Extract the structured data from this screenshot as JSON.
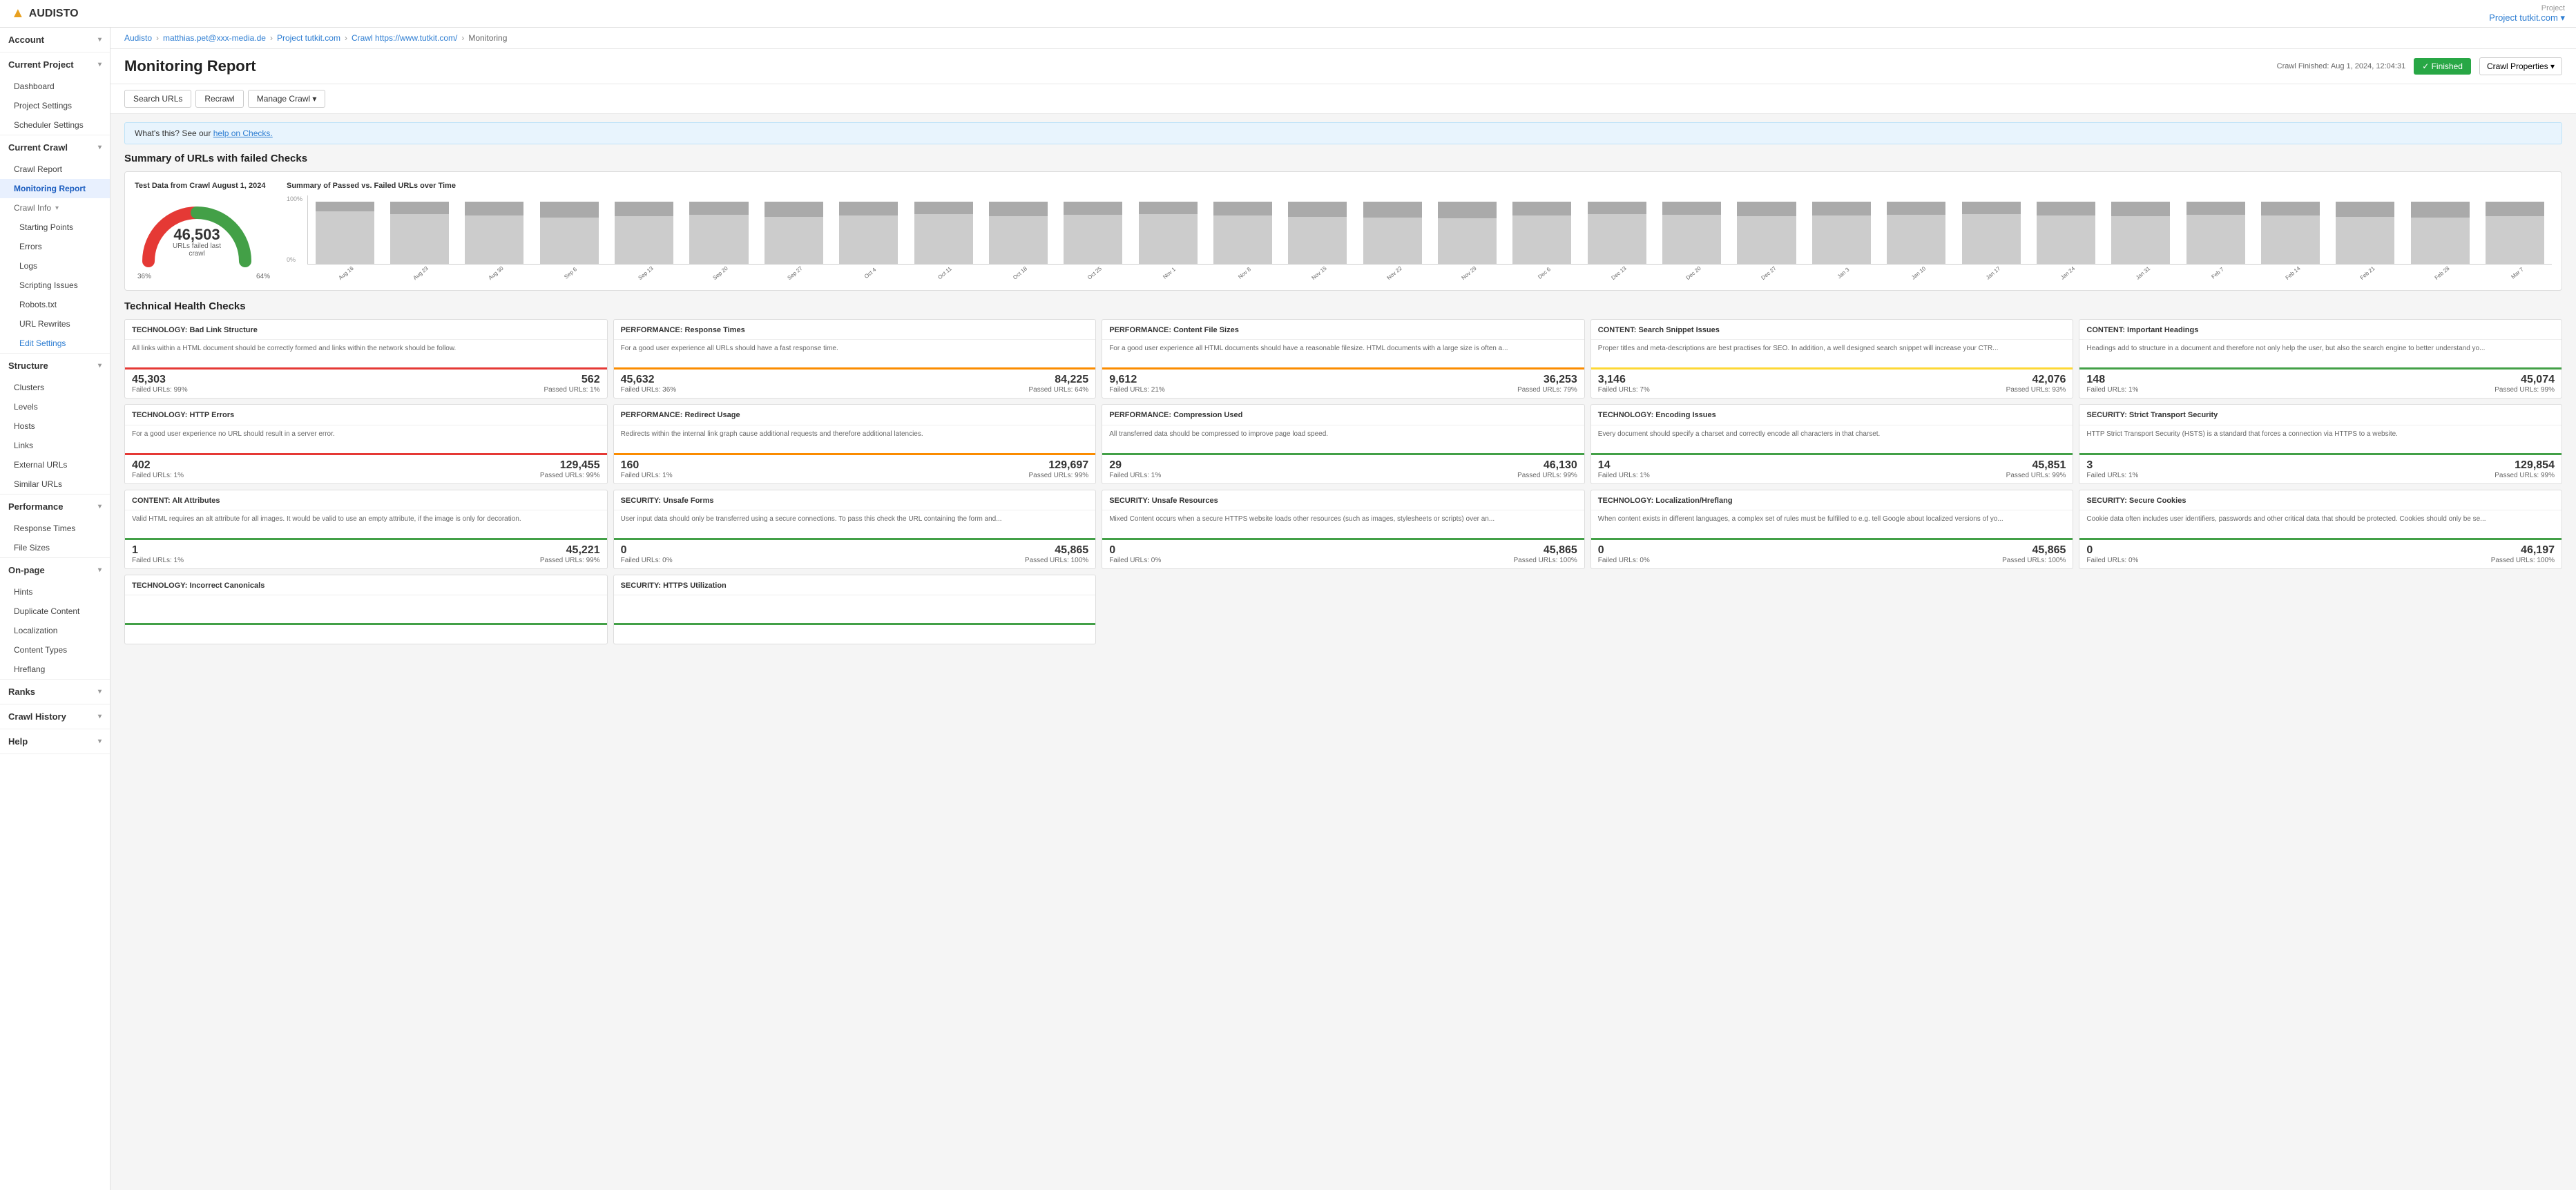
{
  "topbar": {
    "logo_text": "AUDISTO",
    "project_label": "Project",
    "project_name": "Project tutkit.com"
  },
  "breadcrumb": {
    "items": [
      "Audisto",
      "matthias.pet@xxx-media.de",
      "Project tutkit.com",
      "Crawl https://www.tutkit.com/",
      "Monitoring"
    ]
  },
  "page": {
    "title": "Monitoring Report",
    "crawl_finished": "Crawl Finished: Aug 1, 2024, 12:04:31",
    "finished_label": "✓ Finished",
    "crawl_props_label": "Crawl Properties"
  },
  "toolbar": {
    "search_urls": "Search URLs",
    "recrawl": "Recrawl",
    "manage_crawl": "Manage Crawl"
  },
  "info_bar": {
    "text": "What's this? See our ",
    "link_text": "help on Checks.",
    "link_href": "#"
  },
  "summary": {
    "title": "Summary of URLs with failed Checks",
    "gauge": {
      "title": "Test Data from Crawl August 1, 2024",
      "number": "46,503",
      "label": "URLs failed last crawl",
      "pct_left": "36%",
      "pct_right": "64%"
    },
    "chart": {
      "title": "Summary of Passed vs. Failed URLs over Time",
      "y_labels": [
        "100%",
        "0%"
      ],
      "bars": [
        {
          "label": "Aug 16",
          "passed": 85,
          "failed": 15
        },
        {
          "label": "Aug 23",
          "passed": 80,
          "failed": 20
        },
        {
          "label": "Aug 30",
          "passed": 78,
          "failed": 22
        },
        {
          "label": "Sep 6",
          "passed": 75,
          "failed": 25
        },
        {
          "label": "Sep 13",
          "passed": 77,
          "failed": 23
        },
        {
          "label": "Sep 20",
          "passed": 79,
          "failed": 21
        },
        {
          "label": "Sep 27",
          "passed": 76,
          "failed": 24
        },
        {
          "label": "Oct 4",
          "passed": 78,
          "failed": 22
        },
        {
          "label": "Oct 11",
          "passed": 80,
          "failed": 20
        },
        {
          "label": "Oct 18",
          "passed": 77,
          "failed": 23
        },
        {
          "label": "Oct 25",
          "passed": 79,
          "failed": 21
        },
        {
          "label": "Nov 1",
          "passed": 80,
          "failed": 20
        },
        {
          "label": "Nov 8",
          "passed": 78,
          "failed": 22
        },
        {
          "label": "Nov 15",
          "passed": 76,
          "failed": 24
        },
        {
          "label": "Nov 22",
          "passed": 75,
          "failed": 25
        },
        {
          "label": "Nov 29",
          "passed": 73,
          "failed": 27
        },
        {
          "label": "Dec 6",
          "passed": 78,
          "failed": 22
        },
        {
          "label": "Dec 13",
          "passed": 80,
          "failed": 20
        },
        {
          "label": "Dec 20",
          "passed": 79,
          "failed": 21
        },
        {
          "label": "Dec 27",
          "passed": 77,
          "failed": 23
        },
        {
          "label": "Jan 3",
          "passed": 78,
          "failed": 22
        },
        {
          "label": "Jan 10",
          "passed": 79,
          "failed": 21
        },
        {
          "label": "Jan 17",
          "passed": 80,
          "failed": 20
        },
        {
          "label": "Jan 24",
          "passed": 78,
          "failed": 22
        },
        {
          "label": "Jan 31",
          "passed": 77,
          "failed": 23
        },
        {
          "label": "Feb 7",
          "passed": 79,
          "failed": 21
        },
        {
          "label": "Feb 14",
          "passed": 78,
          "failed": 22
        },
        {
          "label": "Feb 21",
          "passed": 76,
          "failed": 24
        },
        {
          "label": "Feb 28",
          "passed": 75,
          "failed": 25
        },
        {
          "label": "Mar 7",
          "passed": 77,
          "failed": 23
        }
      ]
    }
  },
  "health": {
    "title": "Technical Health Checks",
    "cards_row1": [
      {
        "title": "TECHNOLOGY: Bad Link Structure",
        "desc": "All links within a HTML document should be correctly formed and links within the network should be follow.",
        "num_left": "45,303",
        "label_left": "Failed URLs: 99%",
        "num_right": "562",
        "label_right": "Passed URLs: 1%",
        "color": "red"
      },
      {
        "title": "PERFORMANCE: Response Times",
        "desc": "For a good user experience all URLs should have a fast response time.",
        "num_left": "45,632",
        "label_left": "Failed URLs: 36%",
        "num_right": "84,225",
        "label_right": "Passed URLs: 64%",
        "color": "orange"
      },
      {
        "title": "PERFORMANCE: Content File Sizes",
        "desc": "For a good user experience all HTML documents should have a reasonable filesize. HTML documents with a large size is often a...",
        "num_left": "9,612",
        "label_left": "Failed URLs: 21%",
        "num_right": "36,253",
        "label_right": "Passed URLs: 79%",
        "color": "orange"
      },
      {
        "title": "CONTENT: Search Snippet Issues",
        "desc": "Proper titles and meta-descriptions are best practises for SEO. In addition, a well designed search snippet will increase your CTR...",
        "num_left": "3,146",
        "label_left": "Failed URLs: 7%",
        "num_right": "42,076",
        "label_right": "Passed URLs: 93%",
        "color": "yellow"
      },
      {
        "title": "CONTENT: Important Headings",
        "desc": "Headings add to structure in a document and therefore not only help the user, but also the search engine to better understand yo...",
        "num_left": "148",
        "label_left": "Failed URLs: 1%",
        "num_right": "45,074",
        "label_right": "Passed URLs: 99%",
        "color": "green"
      }
    ],
    "cards_row2": [
      {
        "title": "TECHNOLOGY: HTTP Errors",
        "desc": "For a good user experience no URL should result in a server error.",
        "num_left": "402",
        "label_left": "Failed URLs: 1%",
        "num_right": "129,455",
        "label_right": "Passed URLs: 99%",
        "color": "red"
      },
      {
        "title": "PERFORMANCE: Redirect Usage",
        "desc": "Redirects within the internal link graph cause additional requests and therefore additional latencies.",
        "num_left": "160",
        "label_left": "Failed URLs: 1%",
        "num_right": "129,697",
        "label_right": "Passed URLs: 99%",
        "color": "orange"
      },
      {
        "title": "PERFORMANCE: Compression Used",
        "desc": "All transferred data should be compressed to improve page load speed.",
        "num_left": "29",
        "label_left": "Failed URLs: 1%",
        "num_right": "46,130",
        "label_right": "Passed URLs: 99%",
        "color": "green"
      },
      {
        "title": "TECHNOLOGY: Encoding Issues",
        "desc": "Every document should specify a charset and correctly encode all characters in that charset.",
        "num_left": "14",
        "label_left": "Failed URLs: 1%",
        "num_right": "45,851",
        "label_right": "Passed URLs: 99%",
        "color": "green"
      },
      {
        "title": "SECURITY: Strict Transport Security",
        "desc": "HTTP Strict Transport Security (HSTS) is a standard that forces a connection via HTTPS to a website.",
        "num_left": "3",
        "label_left": "Failed URLs: 1%",
        "num_right": "129,854",
        "label_right": "Passed URLs: 99%",
        "color": "green"
      }
    ],
    "cards_row3": [
      {
        "title": "CONTENT: Alt Attributes",
        "desc": "Valid HTML requires an alt attribute for all images. It would be valid to use an empty attribute, if the image is only for decoration.",
        "num_left": "1",
        "label_left": "Failed URLs: 1%",
        "num_right": "45,221",
        "label_right": "Passed URLs: 99%",
        "color": "green"
      },
      {
        "title": "SECURITY: Unsafe Forms",
        "desc": "User input data should only be transferred using a secure connections. To pass this check the URL containing the form and...",
        "num_left": "0",
        "label_left": "Failed URLs: 0%",
        "num_right": "45,865",
        "label_right": "Passed URLs: 100%",
        "color": "green"
      },
      {
        "title": "SECURITY: Unsafe Resources",
        "desc": "Mixed Content occurs when a secure HTTPS website loads other resources (such as images, stylesheets or scripts) over an...",
        "num_left": "0",
        "label_left": "Failed URLs: 0%",
        "num_right": "45,865",
        "label_right": "Passed URLs: 100%",
        "color": "green"
      },
      {
        "title": "TECHNOLOGY: Localization/Hreflang",
        "desc": "When content exists in different languages, a complex set of rules must be fulfilled to e.g. tell Google about localized versions of yo...",
        "num_left": "0",
        "label_left": "Failed URLs: 0%",
        "num_right": "45,865",
        "label_right": "Passed URLs: 100%",
        "color": "green"
      },
      {
        "title": "SECURITY: Secure Cookies",
        "desc": "Cookie data often includes user identifiers, passwords and other critical data that should be protected. Cookies should only be se...",
        "num_left": "0",
        "label_left": "Failed URLs: 0%",
        "num_right": "46,197",
        "label_right": "Passed URLs: 100%",
        "color": "green"
      }
    ],
    "cards_row4": [
      {
        "title": "TECHNOLOGY: Incorrect Canonicals",
        "desc": "",
        "num_left": "",
        "label_left": "",
        "num_right": "",
        "label_right": "",
        "color": "green"
      },
      {
        "title": "SECURITY: HTTPS Utilization",
        "desc": "",
        "num_left": "",
        "label_left": "",
        "num_right": "",
        "label_right": "",
        "color": "green"
      }
    ]
  },
  "sidebar": {
    "account_label": "Account",
    "current_project_label": "Current Project",
    "project_items": [
      "Dashboard",
      "Project Settings",
      "Scheduler Settings"
    ],
    "current_crawl_label": "Current Crawl",
    "crawl_items": [
      "Crawl Report",
      "Monitoring Report"
    ],
    "crawl_info_label": "Crawl Info",
    "crawl_info_items": [
      "Starting Points",
      "Errors",
      "Logs",
      "Scripting Issues",
      "Robots.txt",
      "URL Rewrites",
      "Edit Settings"
    ],
    "structure_label": "Structure",
    "structure_items": [
      "Clusters",
      "Levels",
      "Hosts",
      "Links",
      "External URLs",
      "Similar URLs"
    ],
    "performance_label": "Performance",
    "performance_items": [
      "Response Times",
      "File Sizes"
    ],
    "onpage_label": "On-page",
    "onpage_items": [
      "Hints",
      "Duplicate Content",
      "Localization",
      "Content Types",
      "Hreflang"
    ],
    "ranks_label": "Ranks",
    "crawl_history_label": "Crawl History",
    "help_label": "Help"
  }
}
